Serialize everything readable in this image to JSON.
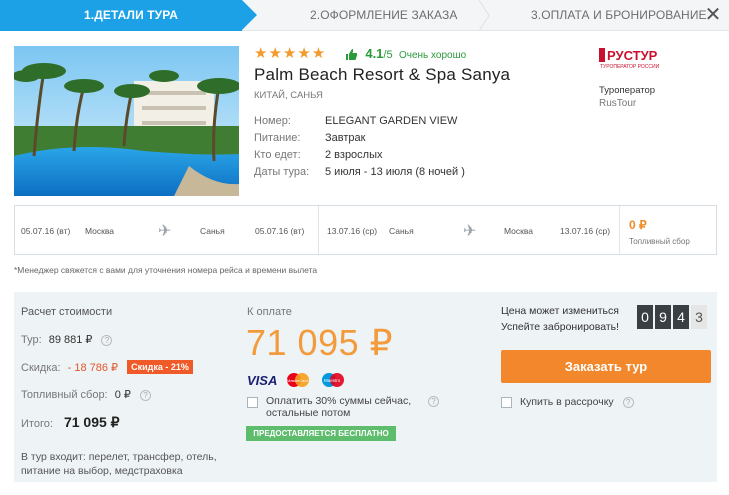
{
  "steps": {
    "step1": "1.ДЕТАЛИ ТУРА",
    "step2": "2.ОФОРМЛЕНИЕ ЗАКАЗА",
    "step3": "3.ОПЛАТА И БРОНИРОВАНИЕ",
    "close_icon": "close-icon"
  },
  "hotel": {
    "stars": "★★★★★",
    "rating_value": "4.1",
    "rating_den": "/5",
    "rating_text": "Очень хорошо",
    "name": "Palm Beach Resort & Spa Sanya",
    "location": "КИТАЙ, САНЬЯ",
    "details": [
      {
        "label": "Номер:",
        "value": "ELEGANT GARDEN VIEW"
      },
      {
        "label": "Питание:",
        "value": "Завтрак"
      },
      {
        "label": "Кто едет:",
        "value": "2 взрослых"
      },
      {
        "label": "Даты тура:",
        "value": "5 июля - 13 июля (8 ночей )"
      }
    ]
  },
  "operator": {
    "logo_text": "РУСТУР",
    "logo_sub": "ТУРОПЕРАТОР РОССИИ",
    "label": "Туроператор",
    "name": "RusTour"
  },
  "flights": {
    "outbound": {
      "date_from": "05.07.16 (вт)",
      "from": "Москва",
      "to": "Санья",
      "date_to": "05.07.16 (вт)"
    },
    "return": {
      "date_from": "13.07.16 (ср)",
      "from": "Санья",
      "to": "Москва",
      "date_to": "13.07.16 (ср)"
    },
    "fuel_amount": "0 ₽",
    "fuel_label": "Топливный сбор"
  },
  "note": "*Менеджер свяжется с вами для уточнения номера рейса и времени вылета",
  "calc": {
    "title": "Расчет стоимости",
    "tour_label": "Тур:",
    "tour_value": "89 881 ₽",
    "discount_label": "Скидка:",
    "discount_value": "- 18 786 ₽",
    "discount_badge": "Скидка - 21%",
    "fuel_label": "Топливный сбор:",
    "fuel_value": "0 ₽",
    "total_label": "Итого:",
    "total_value": "71 095 ₽",
    "includes": "В тур входит: перелет, трансфер, отель, питание на выбор, медстраховка"
  },
  "payment": {
    "title": "К оплате",
    "amount": "71 095 ₽",
    "cards": [
      "VISA",
      "MasterCard",
      "Maestro"
    ],
    "partial_option": "Оплатить 30% суммы сейчас, остальные потом",
    "free_badge": "ПРЕДОСТАВЛЯЕТСЯ БЕСПЛАТНО"
  },
  "booking": {
    "warn_line1": "Цена может измениться",
    "warn_line2": "Успейте забронировать!",
    "timer_digits": [
      "0",
      "9",
      "4",
      "3"
    ],
    "order_button": "Заказать тур",
    "installment_option": "Купить в рассрочку"
  },
  "colors": {
    "accent_blue": "#1da1e6",
    "price_orange": "#f39a3a",
    "button_orange": "#f2872c",
    "discount_red": "#f05a28",
    "rating_green": "#2b9a3b",
    "free_green": "#5dbd6d"
  }
}
